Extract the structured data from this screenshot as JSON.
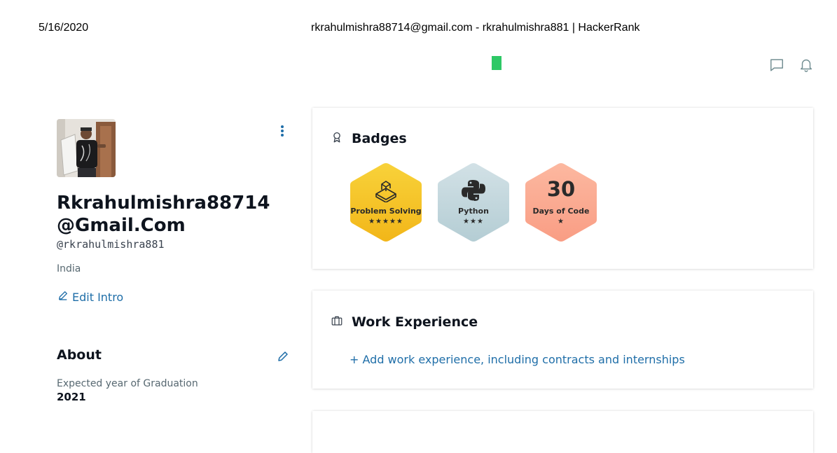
{
  "print_header": {
    "date": "5/16/2020",
    "title": "rkrahulmishra88714@gmail.com - rkrahulmishra881 | HackerRank"
  },
  "topbar": {
    "logo_color": "#2ec866",
    "icons": [
      "chat-icon",
      "notification-bell-icon"
    ]
  },
  "profile": {
    "name": "Rkrahulmishra88714@Gmail.Com",
    "handle": "@rkrahulmishra881",
    "country": "India",
    "edit_intro": "Edit Intro"
  },
  "about": {
    "title": "About",
    "graduation_label": "Expected year of Graduation",
    "graduation_year": "2021"
  },
  "badges": {
    "title": "Badges",
    "items": [
      {
        "name": "Problem Solving",
        "stars": "★★★★★",
        "star_count": 5,
        "icon": "cube-puzzle-icon",
        "color": "#f5c42c"
      },
      {
        "name": "Python",
        "stars": "★★★",
        "star_count": 3,
        "icon": "python-icon",
        "color": "#c2d6dd"
      },
      {
        "name": "Days of Code",
        "number": "30",
        "stars": "★",
        "star_count": 1,
        "color": "#fbad96"
      }
    ]
  },
  "work_experience": {
    "title": "Work Experience",
    "add_link": "+ Add work experience, including contracts and internships"
  },
  "colors": {
    "accent_link": "#1f6ea8",
    "text_primary": "#0e141e",
    "text_secondary": "#576871"
  }
}
